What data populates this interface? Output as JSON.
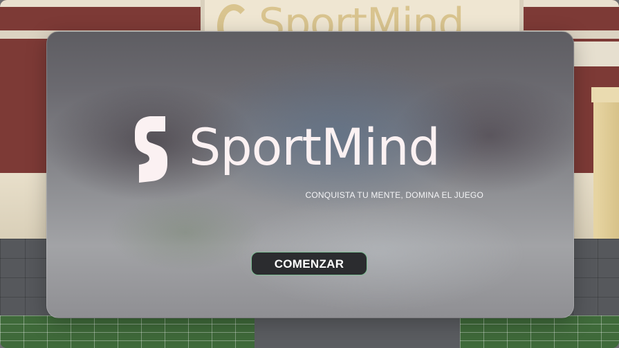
{
  "background_scene": {
    "sign_text": "SportMind"
  },
  "splash": {
    "logo_text": "SportMind",
    "tagline": "CONQUISTA TU MENTE, DOMINA EL JUEGO",
    "start_button_label": "COMENZAR"
  },
  "colors": {
    "logo": "#fbf1f2",
    "button_bg": "#2b2c2f",
    "button_border": "#7dbb93",
    "wall": "#7d3a36",
    "grass": "#3f6a3a"
  }
}
